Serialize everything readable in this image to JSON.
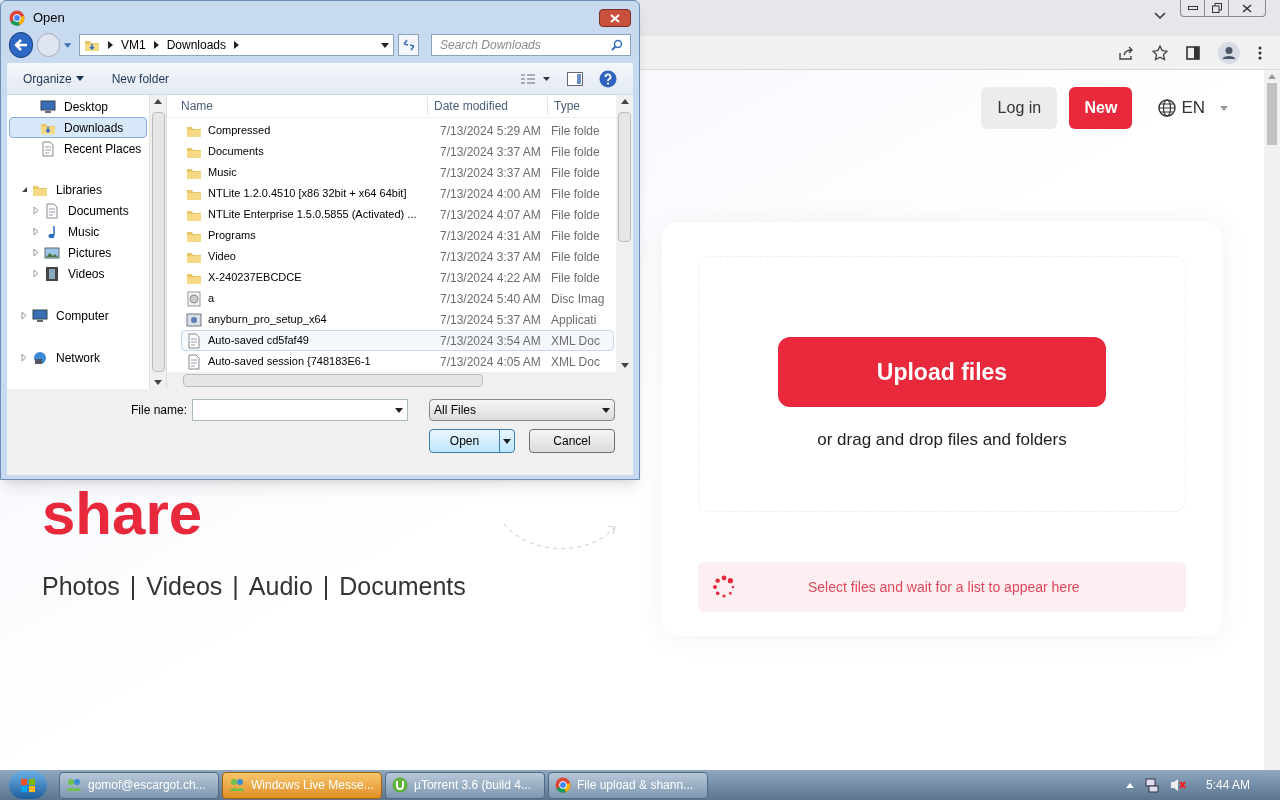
{
  "dialog": {
    "title": "Open",
    "path": [
      "VM1",
      "Downloads"
    ],
    "search_placeholder": "Search Downloads",
    "toolbar": [
      "Organize",
      "New folder"
    ],
    "favorites": [
      {
        "label": "Desktop",
        "kind": "desktop",
        "selected": false
      },
      {
        "label": "Downloads",
        "kind": "downloads",
        "selected": true
      },
      {
        "label": "Recent Places",
        "kind": "recent",
        "selected": false
      }
    ],
    "tree": [
      {
        "label": "Libraries",
        "kind": "library",
        "expanded": true,
        "children": [
          {
            "label": "Documents",
            "kind": "doc",
            "expanded": false
          },
          {
            "label": "Music",
            "kind": "music",
            "expanded": false
          },
          {
            "label": "Pictures",
            "kind": "pictures",
            "expanded": false
          },
          {
            "label": "Videos",
            "kind": "videos",
            "expanded": false
          }
        ]
      },
      {
        "label": "Computer",
        "kind": "computer",
        "expanded": false
      },
      {
        "label": "Network",
        "kind": "network",
        "expanded": false
      }
    ],
    "columns": [
      "Name",
      "Date modified",
      "Type"
    ],
    "files": [
      {
        "name": "Compressed",
        "date": "7/13/2024 5:29 AM",
        "type": "File folde",
        "kind": "folder",
        "hovered": false
      },
      {
        "name": "Documents",
        "date": "7/13/2024 3:37 AM",
        "type": "File folde",
        "kind": "folder",
        "hovered": false
      },
      {
        "name": "Music",
        "date": "7/13/2024 3:37 AM",
        "type": "File folde",
        "kind": "folder",
        "hovered": false
      },
      {
        "name": "NTLite 1.2.0.4510 [x86 32bit + x64 64bit]",
        "date": "7/13/2024 4:00 AM",
        "type": "File folde",
        "kind": "folder",
        "hovered": false
      },
      {
        "name": "NTLite Enterprise 1.5.0.5855 (Activated) ...",
        "date": "7/13/2024 4:07 AM",
        "type": "File folde",
        "kind": "folder",
        "hovered": false
      },
      {
        "name": "Programs",
        "date": "7/13/2024 4:31 AM",
        "type": "File folde",
        "kind": "folder",
        "hovered": false
      },
      {
        "name": "Video",
        "date": "7/13/2024 3:37 AM",
        "type": "File folde",
        "kind": "folder",
        "hovered": false
      },
      {
        "name": "X-240237EBCDCE",
        "date": "7/13/2024 4:22 AM",
        "type": "File folde",
        "kind": "folder",
        "hovered": false
      },
      {
        "name": "a",
        "date": "7/13/2024 5:40 AM",
        "type": "Disc Imag",
        "kind": "disc",
        "hovered": false
      },
      {
        "name": "anyburn_pro_setup_x64",
        "date": "7/13/2024 5:37 AM",
        "type": "Applicati",
        "kind": "app",
        "hovered": false
      },
      {
        "name": "Auto-saved cd5faf49",
        "date": "7/13/2024 3:54 AM",
        "type": "XML Doc",
        "kind": "xml",
        "hovered": true
      },
      {
        "name": "Auto-saved session {748183E6-1",
        "date": "7/13/2024 4:05 AM",
        "type": "XML Doc",
        "kind": "xml",
        "hovered": false
      }
    ],
    "file_name_label": "File name:",
    "filter": "All Files",
    "open_button": "Open",
    "cancel_button": "Cancel"
  },
  "page": {
    "login": "Log in",
    "new": "New",
    "language": "EN",
    "headline": "share",
    "categories": [
      "Photos",
      "Videos",
      "Audio",
      "Documents"
    ],
    "separator": "|",
    "upload_button": "Upload files",
    "drop_hint": "or drag and drop files and folders",
    "status": "Select files and wait for a list to appear here"
  },
  "taskbar": [
    {
      "label": "gomof@escargot.ch...",
      "kind": "messenger",
      "selected": false
    },
    {
      "label": "Windows Live Messe...",
      "kind": "messenger",
      "selected": true
    },
    {
      "label": "µTorrent 3.6  (build 4...",
      "kind": "torrent",
      "selected": false
    },
    {
      "label": "File upload & shann...",
      "kind": "chrome",
      "selected": false
    }
  ],
  "clock": "5:44 AM"
}
